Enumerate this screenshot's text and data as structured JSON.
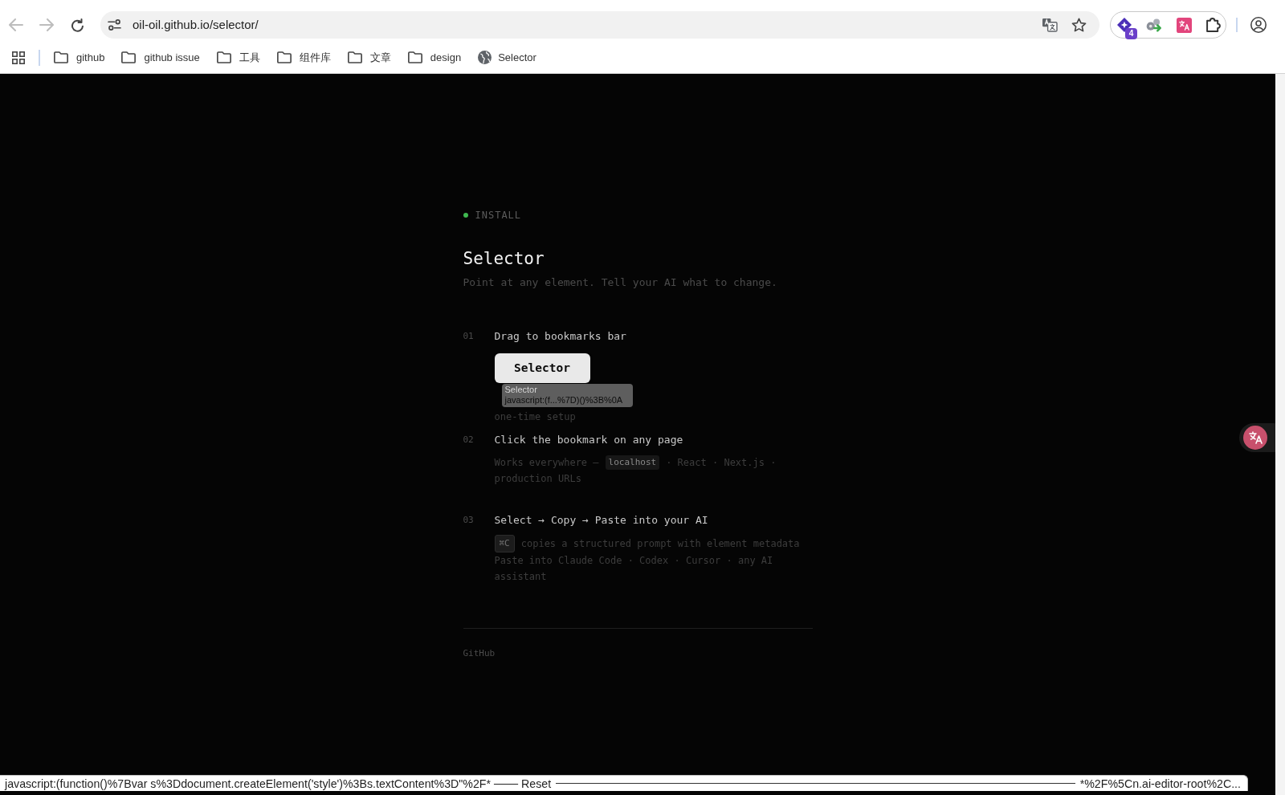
{
  "browser": {
    "toolbar": {
      "back_disabled": true,
      "forward_disabled": true,
      "url": "oil-oil.github.io/selector/",
      "extension_badge": "4"
    },
    "bookmarks": [
      {
        "kind": "folder",
        "label": "github"
      },
      {
        "kind": "folder",
        "label": "github issue"
      },
      {
        "kind": "folder",
        "label": "工具"
      },
      {
        "kind": "folder",
        "label": "组件库"
      },
      {
        "kind": "folder",
        "label": "文章"
      },
      {
        "kind": "folder",
        "label": "design"
      },
      {
        "kind": "site",
        "label": "Selector"
      }
    ]
  },
  "page": {
    "eyebrow": "INSTALL",
    "title": "Selector",
    "subtitle": "Point at any element. Tell your AI what to change.",
    "steps": [
      {
        "number": "01",
        "title": "Drag to bookmarks bar",
        "bookmarklet": {
          "label": "Selector",
          "drag_preview": {
            "title": "Selector",
            "url": "javascript:(f...%7D)()%3B%0A"
          }
        },
        "paragraphs": [
          [
            {
              "kind": "text",
              "text": "one-time setup"
            }
          ]
        ]
      },
      {
        "number": "02",
        "title": "Click the bookmark on any page",
        "paragraphs": [
          [
            {
              "kind": "text",
              "text": "Works everywhere —"
            },
            {
              "kind": "code",
              "text": "localhost"
            },
            {
              "kind": "text",
              "text": "· React · Next.js ·"
            },
            {
              "kind": "text",
              "text": "production URLs"
            }
          ]
        ]
      },
      {
        "number": "03",
        "title": "Select → Copy → Paste into your AI",
        "paragraphs": [
          [
            {
              "kind": "key",
              "text": "⌘C"
            },
            {
              "kind": "text",
              "text": "copies a structured prompt with element metadata"
            }
          ],
          [
            {
              "kind": "text",
              "text": "Paste into Claude Code · Codex · Cursor · any AI assistant"
            }
          ]
        ]
      }
    ],
    "footer_link": "GitHub"
  },
  "status_bar": {
    "text_start": "javascript:(function()%7Bvar s%3Ddocument.createElement('style')%3Bs.textContent%3D\"%2F* ─── Reset",
    "text_end": "*%2F%5Cn.ai-editor-root%2C..."
  }
}
